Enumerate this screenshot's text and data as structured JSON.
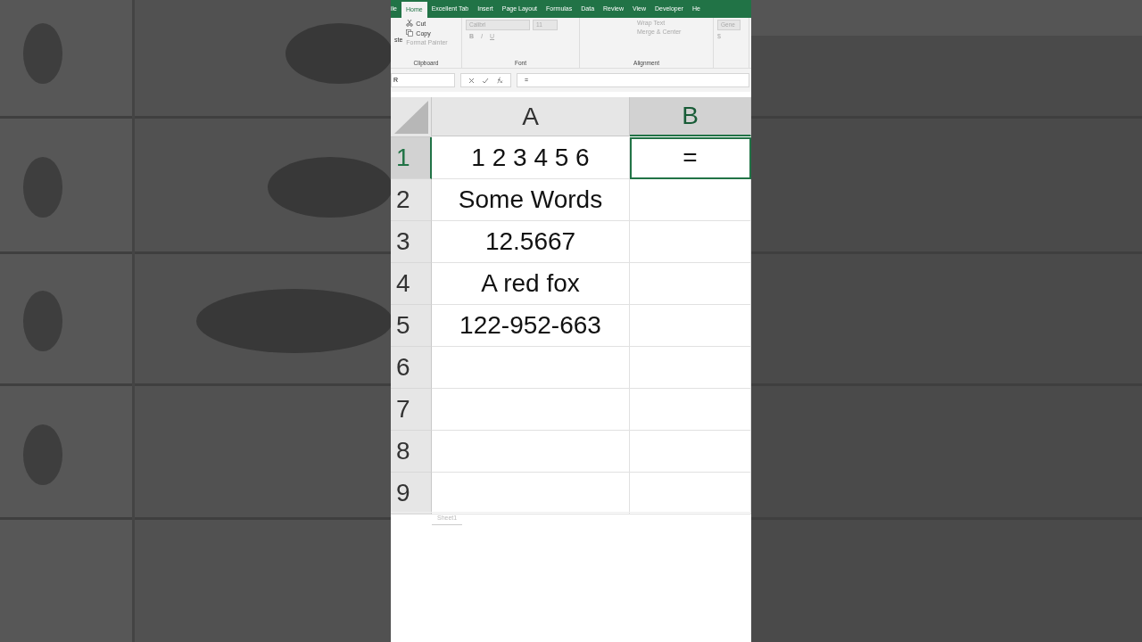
{
  "ribbon_tabs": [
    {
      "label": "ile",
      "selected": false
    },
    {
      "label": "Home",
      "selected": true
    },
    {
      "label": "Excellent Tab",
      "selected": false
    },
    {
      "label": "Insert",
      "selected": false
    },
    {
      "label": "Page Layout",
      "selected": false
    },
    {
      "label": "Formulas",
      "selected": false
    },
    {
      "label": "Data",
      "selected": false
    },
    {
      "label": "Review",
      "selected": false
    },
    {
      "label": "View",
      "selected": false
    },
    {
      "label": "Developer",
      "selected": false
    },
    {
      "label": "He",
      "selected": false
    }
  ],
  "clipboard": {
    "paste": "ste",
    "cut": "Cut",
    "copy": "Copy",
    "format_painter": "Format Painter",
    "label": "Clipboard"
  },
  "font": {
    "name": "Calibri",
    "size": "11",
    "bold": "B",
    "italic": "I",
    "underline": "U",
    "label": "Font"
  },
  "alignment": {
    "wrap": "Wrap Text",
    "merge": "Merge & Center",
    "label": "Alignment"
  },
  "number": {
    "format": "Gene",
    "currency": "$"
  },
  "formula_bar": {
    "name_box": "R",
    "value": "="
  },
  "columns": [
    {
      "label": "A",
      "selected": false
    },
    {
      "label": "B",
      "selected": true
    }
  ],
  "rows": [
    {
      "number": "1",
      "selected": true,
      "cells": [
        {
          "value": "1 2 3 4 5 6",
          "selected": false
        },
        {
          "value": "=",
          "selected": true
        }
      ]
    },
    {
      "number": "2",
      "selected": false,
      "cells": [
        {
          "value": "Some Words",
          "selected": false
        },
        {
          "selected": false
        }
      ]
    },
    {
      "number": "3",
      "selected": false,
      "cells": [
        {
          "value": "12.5667",
          "selected": false
        },
        {
          "selected": false
        }
      ]
    },
    {
      "number": "4",
      "selected": false,
      "cells": [
        {
          "value": "A red fox",
          "selected": false
        },
        {
          "selected": false
        }
      ]
    },
    {
      "number": "5",
      "selected": false,
      "cells": [
        {
          "value": "122-952-663",
          "selected": false
        },
        {
          "selected": false
        }
      ]
    },
    {
      "number": "6",
      "selected": false,
      "cells": [
        {
          "selected": false
        },
        {
          "selected": false
        }
      ]
    },
    {
      "number": "7",
      "selected": false,
      "cells": [
        {
          "selected": false
        },
        {
          "selected": false
        }
      ]
    },
    {
      "number": "8",
      "selected": false,
      "cells": [
        {
          "selected": false
        },
        {
          "selected": false
        }
      ]
    },
    {
      "number": "9",
      "selected": false,
      "cells": [
        {
          "selected": false
        },
        {
          "selected": false
        }
      ]
    }
  ],
  "sheet_tabs": [
    {
      "label": "Sheet1",
      "selected": true
    }
  ]
}
